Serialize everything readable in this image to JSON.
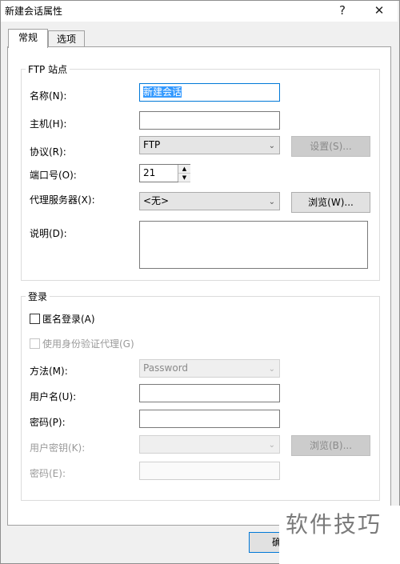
{
  "window": {
    "title": "新建会话属性",
    "help_icon": "?",
    "close_icon": "✕"
  },
  "tabs": [
    {
      "label": "常规",
      "active": true
    },
    {
      "label": "选项",
      "active": false
    }
  ],
  "ftp_site": {
    "legend": "FTP 站点",
    "name_label": "名称(N):",
    "name_value": "新建会话",
    "host_label": "主机(H):",
    "host_value": "",
    "protocol_label": "协议(R):",
    "protocol_value": "FTP",
    "settings_button": "设置(S)...",
    "port_label": "端口号(O):",
    "port_value": "21",
    "proxy_label": "代理服务器(X):",
    "proxy_value": "<无>",
    "browse_button": "浏览(W)...",
    "description_label": "说明(D):",
    "description_value": ""
  },
  "login": {
    "legend": "登录",
    "anonymous_label": "匿名登录(A)",
    "anonymous_checked": false,
    "auth_proxy_label": "使用身份验证代理(G)",
    "auth_proxy_checked": false,
    "method_label": "方法(M):",
    "method_value": "Password",
    "username_label": "用户名(U):",
    "username_value": "",
    "password_label": "密码(P):",
    "password_value": "",
    "user_key_label": "用户密钥(K):",
    "user_key_value": "",
    "browse_b_button": "浏览(B)...",
    "passphrase_label": "密码(E):",
    "passphrase_value": ""
  },
  "footer": {
    "ok_button_partial": "确"
  },
  "watermark": "软件技巧"
}
